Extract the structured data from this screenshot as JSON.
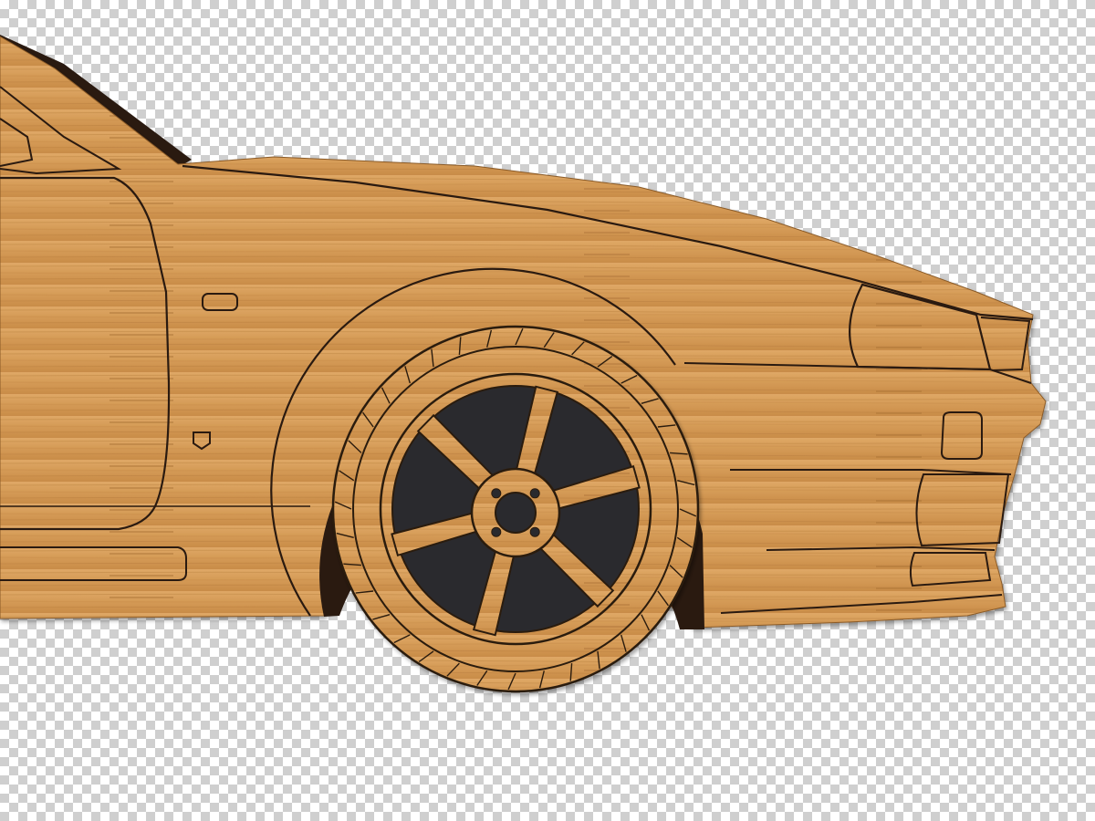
{
  "canvas": {
    "background_pattern": "transparency-checkerboard",
    "checker_light": "#ffffff",
    "checker_dark": "#cfcfcf"
  },
  "artwork": {
    "subject": "car-front-quarter",
    "material": "bamboo-wood",
    "wood_color": "#D9A05C",
    "wood_color_dark": "#B87A3A",
    "engraving_color": "#2a1a10",
    "wheel_inset_color": "#2b2b2e",
    "wheel_spokes": 6,
    "wheel_lug_nuts": 4
  }
}
